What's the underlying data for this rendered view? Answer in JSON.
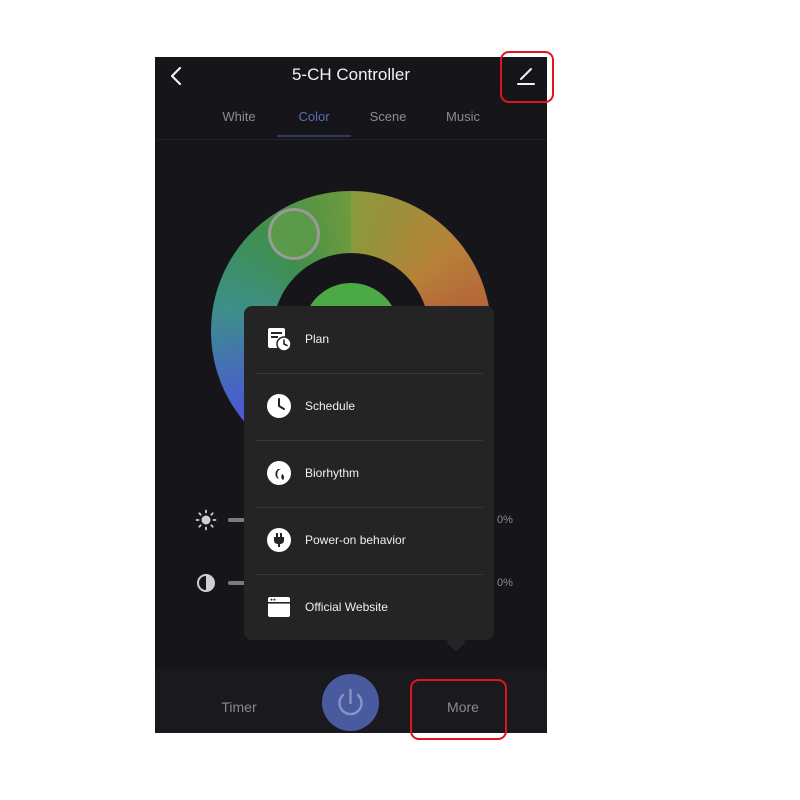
{
  "header": {
    "title": "5-CH Controller",
    "back_icon": "chevron-left-icon",
    "edit_icon": "edit-pencil-icon"
  },
  "tabs": [
    {
      "label": "White",
      "active": false
    },
    {
      "label": "Color",
      "active": true
    },
    {
      "label": "Scene",
      "active": false
    },
    {
      "label": "Music",
      "active": false
    }
  ],
  "sliders": [
    {
      "name": "brightness",
      "icon": "sun-icon",
      "value_text": "0%"
    },
    {
      "name": "saturation",
      "icon": "contrast-icon",
      "value_text": "0%"
    }
  ],
  "color": {
    "selected": "#4caa46",
    "accent": "#4a5a9e"
  },
  "menu": {
    "items": [
      {
        "label": "Plan",
        "icon": "plan-calendar-clock-icon"
      },
      {
        "label": "Schedule",
        "icon": "clock-icon"
      },
      {
        "label": "Biorhythm",
        "icon": "moon-leaf-icon"
      },
      {
        "label": "Power-on behavior",
        "icon": "plug-icon"
      },
      {
        "label": "Official Website",
        "icon": "browser-window-icon"
      }
    ]
  },
  "bottom_bar": {
    "timer_label": "Timer",
    "more_label": "More",
    "power_icon": "power-icon"
  },
  "highlight_color": "#e0141e"
}
